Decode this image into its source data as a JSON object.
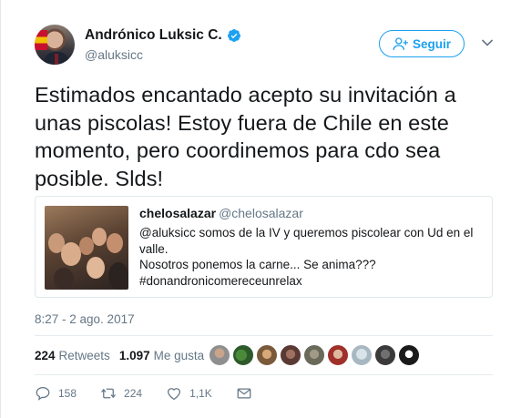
{
  "author": {
    "name": "Andrónico Luksic C.",
    "handle": "@aluksicc",
    "verified_icon": "verified-badge-icon"
  },
  "follow_button": {
    "label": "Seguir",
    "icon": "person-add-icon"
  },
  "tweet_text": "Estimados encantado acepto su invitación a unas piscolas! Estoy fuera de Chile en este momento, pero coordinemos para cdo sea posible. Slds!",
  "quoted_tweet": {
    "name": "chelosalazar",
    "handle": "@chelosalazar",
    "text_lines": [
      "@aluksicc somos de la IV y queremos piscolear con Ud en el valle.",
      "Nosotros ponemos la carne... Se anima???",
      "#donandronicomereceunrelax"
    ],
    "media": "group-selfie-photo"
  },
  "timestamp": "8:27 - 2 ago. 2017",
  "stats": {
    "retweets_count": "224",
    "retweets_label": "Retweets",
    "likes_count": "1.097",
    "likes_label": "Me gusta"
  },
  "actions": {
    "reply_count": "158",
    "retweet_count": "224",
    "like_count": "1,1K"
  },
  "colors": {
    "accent": "#1da1f2",
    "text": "#14171a",
    "secondary": "#657786",
    "border": "#e1e8ed"
  }
}
